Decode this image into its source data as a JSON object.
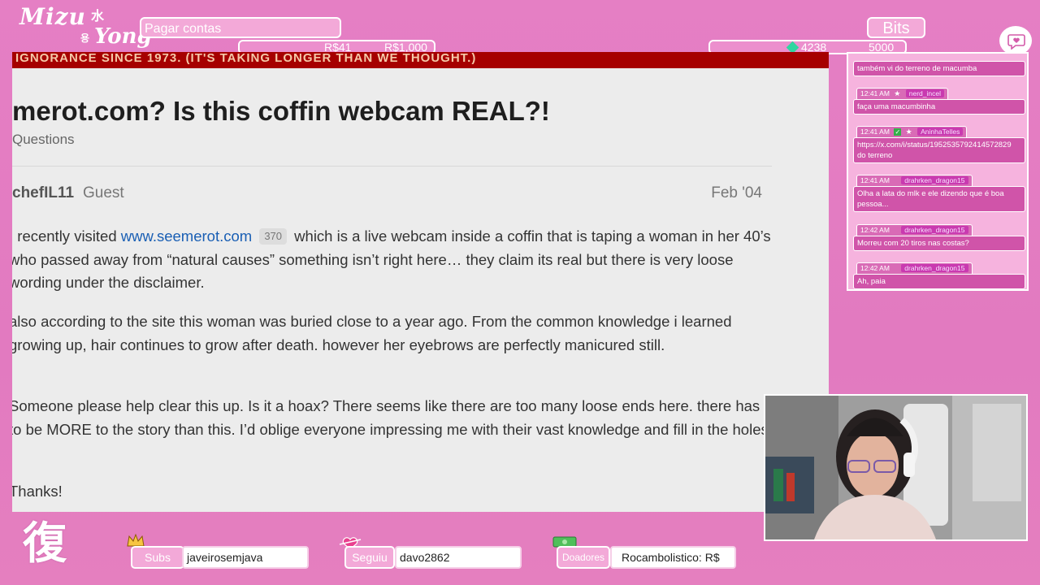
{
  "overlay": {
    "logo_main": "Mizu",
    "logo_kanji": "水",
    "logo_hangul": "용",
    "logo_sub": "Yong",
    "goal": {
      "title": "Pagar contas",
      "current": "R$41",
      "target": "R$1,000"
    },
    "bits": {
      "title": "Bits",
      "current": "4238",
      "target": "5000"
    },
    "corner_glyph": "復",
    "bottom": {
      "subs_label": "Subs",
      "subs_value": "javeirosemjava",
      "follow_label": "Seguiu",
      "follow_value": "davo2862",
      "donors_label": "Doadores",
      "donors_value": "Rocambolistico: R$"
    }
  },
  "webpage": {
    "banner": "IGNORANCE SINCE 1973. (IT'S TAKING LONGER THAN WE THOUGHT.)",
    "title": "merot.com? Is this coffin webcam REAL?!",
    "breadcrumb": "Questions",
    "author": "chefIL11",
    "role": "Guest",
    "date": "Feb '04",
    "p1_a": "I recently visited ",
    "p1_link": "www.seemerot.com",
    "p1_badge": "370",
    "p1_b": " which is a live webcam inside a coffin that is taping a woman in her 40’s who passed away from “natural causes” something isn’t right here… they claim its real but there is very loose wording under the disclaimer.",
    "p2": "also according to the site this woman was buried close to a year ago. From the common knowledge i learned growing up, hair continues to grow after death. however her eyebrows are perfectly manicured still.",
    "p3": "Someone please help clear this up. Is it a hoax? There seems like there are too many loose ends here. there has to be MORE to the story than this. I’d oblige everyone impressing me with their vast knowledge and fill in the holes.",
    "p4": "Thanks!"
  },
  "chat": {
    "messages": [
      {
        "time": "",
        "user": "",
        "text": "também vi do terreno de macumba"
      },
      {
        "time": "12:41 AM",
        "user": "nerd_incel",
        "text": "faça uma macumbinha"
      },
      {
        "time": "12:41 AM",
        "user": "AninhaTelles",
        "text": "https://x.com/i/status/1952535792414572829 do terreno"
      },
      {
        "time": "12:41 AM",
        "user": "drahrken_dragon15",
        "text": "Olha a lata do mlk e ele dizendo que é boa pessoa..."
      },
      {
        "time": "12:42 AM",
        "user": "drahrken_dragon15",
        "text": "Morreu com 20 tiros nas costas?"
      },
      {
        "time": "12:42 AM",
        "user": "drahrken_dragon15",
        "text": "Ah, paia"
      }
    ]
  },
  "colors": {
    "overlay_pink": "#e57fc4",
    "panel_pink": "#f3a9d8",
    "banner_red": "#a60000",
    "link_blue": "#1a5fb4",
    "chat_name_bg": "#c93ab0"
  },
  "icons": [
    "crown-icon",
    "heart-icon",
    "money-icon",
    "gem-icon",
    "chat-heart-icon"
  ]
}
